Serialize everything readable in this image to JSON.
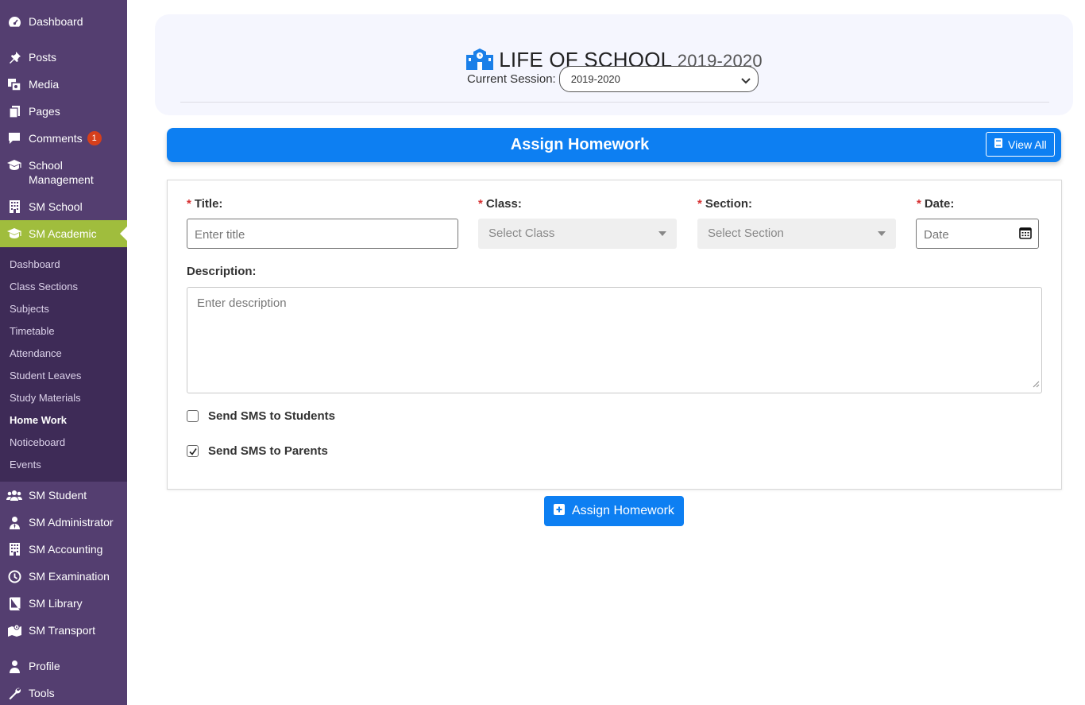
{
  "sidebar": {
    "items": [
      {
        "label": "Dashboard",
        "icon": "dashboard-icon"
      },
      {
        "label": "Posts",
        "icon": "pin-icon"
      },
      {
        "label": "Media",
        "icon": "media-icon"
      },
      {
        "label": "Pages",
        "icon": "pages-icon"
      },
      {
        "label": "Comments",
        "icon": "comment-icon",
        "badge": "1"
      },
      {
        "label": "School\nManagement",
        "icon": "graduation-cap-icon"
      },
      {
        "label": "SM School",
        "icon": "building-icon"
      },
      {
        "label": "SM Academic",
        "icon": "graduation-cap-icon"
      },
      {
        "label": "SM Student",
        "icon": "users-icon"
      },
      {
        "label": "SM Administrator",
        "icon": "user-tie-icon"
      },
      {
        "label": "SM Accounting",
        "icon": "building-icon"
      },
      {
        "label": "SM Examination",
        "icon": "clock-icon"
      },
      {
        "label": "SM Library",
        "icon": "book-icon"
      },
      {
        "label": "SM Transport",
        "icon": "map-icon"
      },
      {
        "label": "Profile",
        "icon": "user-icon"
      },
      {
        "label": "Tools",
        "icon": "wrench-icon"
      }
    ],
    "submenu": [
      "Dashboard",
      "Class Sections",
      "Subjects",
      "Timetable",
      "Attendance",
      "Student Leaves",
      "Study Materials",
      "Home Work",
      "Noticeboard",
      "Events"
    ],
    "current_submenu": "Home Work"
  },
  "header": {
    "title": "LIFE OF SCHOOL",
    "year": "2019-2020",
    "session_label": "Current Session:",
    "session_value": "2019-2020"
  },
  "bar": {
    "title": "Assign Homework",
    "view_all": "View All"
  },
  "form": {
    "title_label": "Title:",
    "title_placeholder": "Enter title",
    "class_label": "Class:",
    "class_placeholder": "Select Class",
    "section_label": "Section:",
    "section_placeholder": "Select Section",
    "date_label": "Date:",
    "date_placeholder": "Date",
    "required_mark": "*",
    "description_label": "Description:",
    "description_placeholder": "Enter description",
    "sms_students": {
      "label": "Send SMS to Students",
      "checked": false
    },
    "sms_parents": {
      "label": "Send SMS to Parents",
      "checked": true
    }
  },
  "submit_label": "Assign Homework",
  "colors": {
    "sidebar": "#543e70",
    "submenu": "#3e2b57",
    "active": "#a0bd3d",
    "primary": "#0d7ff2",
    "badge": "#d63f1c"
  }
}
